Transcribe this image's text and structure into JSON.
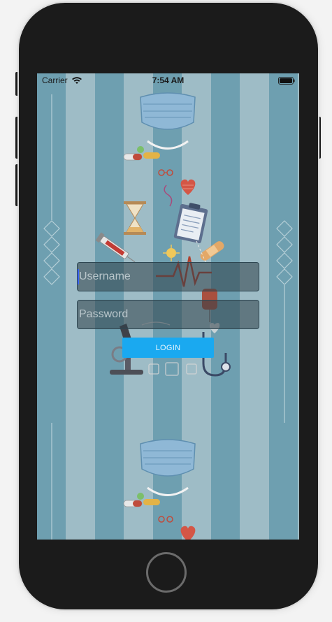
{
  "status_bar": {
    "carrier": "Carrier",
    "time": "7:54 AM"
  },
  "login_form": {
    "username_placeholder": "Username",
    "password_placeholder": "Password",
    "login_label": "LOGIN"
  },
  "colors": {
    "stripe_dark": "#6e9fb0",
    "stripe_light": "#9ebcc6",
    "button": "#1aa9f0",
    "phone_body": "#1b1b1b"
  },
  "icons": {
    "status": [
      "wifi-icon",
      "battery-icon"
    ],
    "background": [
      "face-mask-icon",
      "pills-icon",
      "heart-icon",
      "hourglass-icon",
      "clipboard-icon",
      "syringe-icon",
      "bandage-icon",
      "heartbeat-icon",
      "blood-bag-icon",
      "microscope-icon",
      "stethoscope-icon",
      "diamond-ornament-icon"
    ]
  }
}
